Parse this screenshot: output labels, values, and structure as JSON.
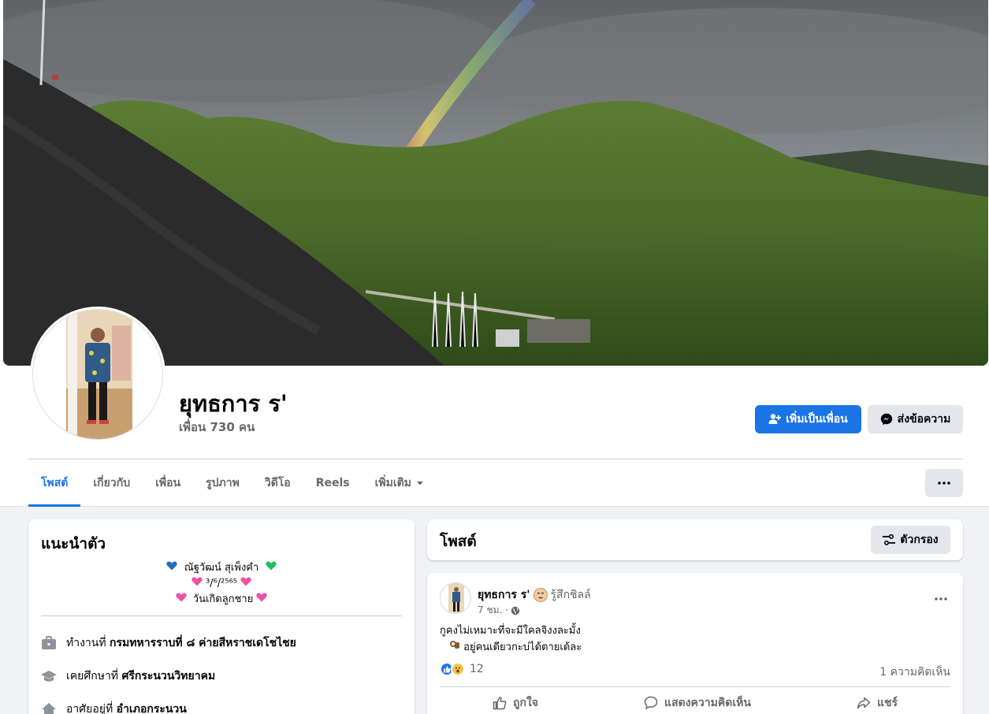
{
  "profile": {
    "name": "ยุทธการ ร'",
    "friends": "เพื่อน 730 คน"
  },
  "actions": {
    "add_friend": "เพิ่มเป็นเพื่อน",
    "message": "ส่งข้อความ"
  },
  "tabs": [
    {
      "label": "โพสต์",
      "active": true
    },
    {
      "label": "เกี่ยวกับ"
    },
    {
      "label": "เพื่อน"
    },
    {
      "label": "รูปภาพ"
    },
    {
      "label": "วิดีโอ"
    },
    {
      "label": "Reels"
    },
    {
      "label": "เพิ่มเติม"
    }
  ],
  "intro": {
    "title": "แนะนำตัว",
    "bio": {
      "line1": "ณัฐวัฒน์ สุเพ็งคำ",
      "line2_date": "³/⁶/²⁵⁶⁵",
      "line3": "วันเกิดลูกชาย"
    },
    "work_prefix": "ทำงานที่",
    "work": "กรมทหารราบที่ ๘ ค่ายสีหราชเดโชไชย",
    "study_prefix": "เคยศึกษาที่",
    "study": "ศรีกระนวนวิทยาคม",
    "live_prefix": "อาศัยอยู่ที่",
    "live": "อำเภอกระนวน"
  },
  "posts_header": {
    "title": "โพสต์",
    "filter": "ตัวกรอง"
  },
  "post": {
    "author": "ยุทธการ ร'",
    "feeling": "รู้สึกชิลล์",
    "time": "7 ชม. ·",
    "text_line1": "กูคงไม่เหมาะที่จะมีใคลจิงงละมั้ง",
    "text_line2": "อยู่คนเดียวกะบ่ได้ตายเด้ละ",
    "reaction_count": "12",
    "comments": "1 ความคิดเห็น",
    "like": "ถูกใจ",
    "comment": "แสดงความคิดเห็น",
    "share": "แชร์"
  },
  "colors": {
    "accent": "#1b74e4",
    "background": "#f0f2f5",
    "secondary_text": "#65676b"
  }
}
